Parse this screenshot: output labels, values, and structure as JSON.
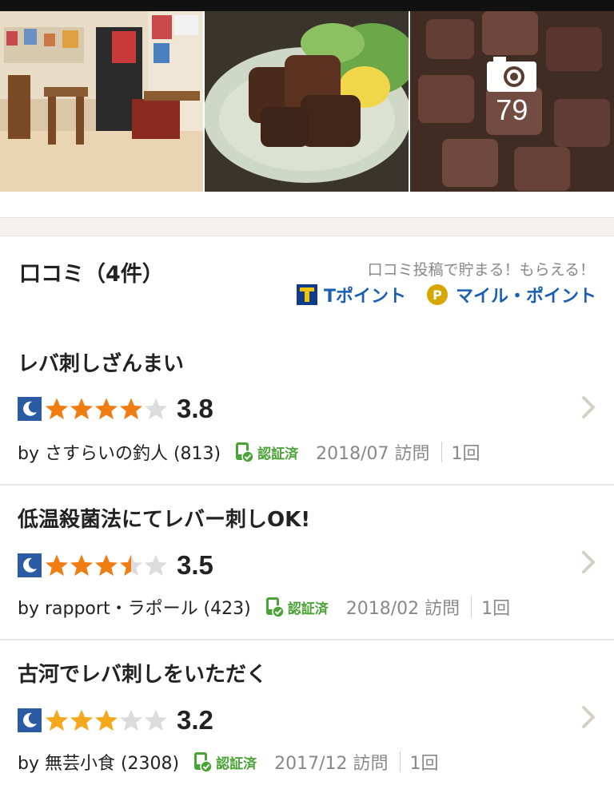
{
  "photos": {
    "count": "79",
    "items": [
      {
        "name": "restaurant-interior-photo"
      },
      {
        "name": "food-dish-photo"
      },
      {
        "name": "grilled-skewers-photo"
      }
    ]
  },
  "reviews_section": {
    "title": "口コミ（4件）",
    "promo_text": "口コミ投稿で貯まる！もらえる！",
    "t_point_label": "Tポイント",
    "p_badge_letter": "P",
    "mile_point_label": "マイル・ポイント"
  },
  "reviews": [
    {
      "title": "レバ刺しざんまい",
      "rating": "3.8",
      "rating_value": 3.8,
      "by": "by さすらいの釣人 (813)",
      "verified_label": "認証済",
      "visit_date": "2018/07 訪問",
      "visit_count": "1回"
    },
    {
      "title": "低温殺菌法にてレバー刺しOK!",
      "rating": "3.5",
      "rating_value": 3.5,
      "by": "by rapport・ラポール (423)",
      "verified_label": "認証済",
      "visit_date": "2018/02 訪問",
      "visit_count": "1回"
    },
    {
      "title": "古河でレバ刺しをいただく",
      "rating": "3.2",
      "rating_value": 3.2,
      "by": "by 無芸小食 (2308)",
      "verified_label": "認証済",
      "visit_date": "2017/12 訪問",
      "visit_count": "1回"
    }
  ],
  "colors": {
    "star_high": "#f07d12",
    "star_mid": "#f5a81c",
    "star_empty": "#dcdcdc",
    "moon_bg": "#2a5ba3",
    "link_blue": "#1b5fb3",
    "verified_green": "#4aa336"
  }
}
